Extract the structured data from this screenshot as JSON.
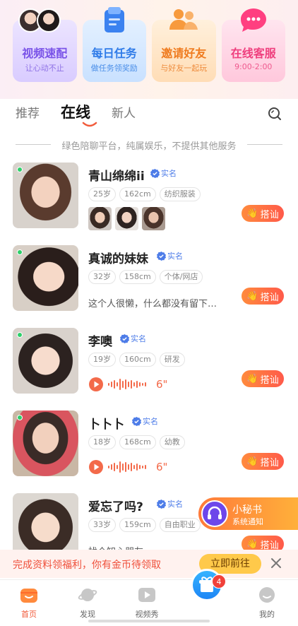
{
  "cards": [
    {
      "title": "视频速配",
      "subtitle": "让心动不止",
      "icon": "avatars-icon"
    },
    {
      "title": "每日任务",
      "subtitle": "做任务领奖励",
      "icon": "task-card-icon"
    },
    {
      "title": "邀请好友",
      "subtitle": "与好友一起玩",
      "icon": "friends-icon"
    },
    {
      "title": "在线客服",
      "subtitle": "9:00-2:00",
      "icon": "chat-bubble-icon"
    }
  ],
  "tabs": [
    "推荐",
    "在线",
    "新人"
  ],
  "active_tab": "在线",
  "notice": "绿色陪聊平台，纯属娱乐，不提供其他服务",
  "verify_label": "实名",
  "greet_label": "搭讪",
  "users": [
    {
      "name": "青山绵绵ii",
      "tags": [
        "25岁",
        "162cm",
        "纺织服装"
      ],
      "extra": "photos"
    },
    {
      "name": "真诚的妹妹",
      "tags": [
        "32岁",
        "158cm",
        "个体/网店"
      ],
      "bio": "这个人很懒，什么都没有留下…"
    },
    {
      "name": "李噢",
      "tags": [
        "19岁",
        "160cm",
        "研发"
      ],
      "voice": "6\""
    },
    {
      "name": "卜卜卜",
      "tags": [
        "18岁",
        "168cm",
        "幼教"
      ],
      "voice": "6\""
    },
    {
      "name": "爱忘了吗?",
      "tags": [
        "33岁",
        "159cm",
        "自由职业"
      ],
      "bio": "找个知心朋友"
    }
  ],
  "secretary": {
    "title": "小秘书",
    "subtitle": "系统通知"
  },
  "promo": {
    "text": "完成资料领福利，你有金币待领取",
    "button": "立即前往"
  },
  "nav": {
    "items": [
      "首页",
      "发现",
      "视频秀",
      "",
      "我的"
    ],
    "badge": "4"
  },
  "colors": {
    "accent": "#f15a3a",
    "online": "#2ecf6a",
    "verify": "#4d7ce8"
  }
}
